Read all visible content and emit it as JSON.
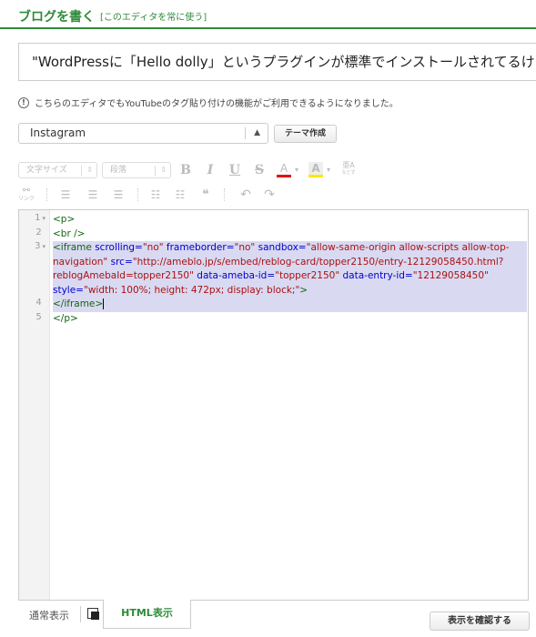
{
  "header": {
    "title": "ブログを書く",
    "link": "[このエディタを常に使う]"
  },
  "post": {
    "title_value": "\"WordPressに「Hello dolly」というプラグインが標準でインストールされてるけ\""
  },
  "notice": {
    "icon": "!",
    "text": "こちらのエディタでもYouTubeのタグ貼り付けの機能がご利用できるようになりました。"
  },
  "theme": {
    "selected": "Instagram",
    "create_button": "テーマ作成"
  },
  "toolbar": {
    "font_size": "文字サイズ",
    "paragraph": "段落",
    "bold": "B",
    "italic": "I",
    "underline": "U",
    "strike": "S",
    "font_color": "A",
    "bg_color": "A",
    "ruby_top": "亜A",
    "ruby_bottom": "などず",
    "link_top": "⚯",
    "link_label": "リンク",
    "quote": "❝",
    "undo": "↶",
    "redo": "↷"
  },
  "editor": {
    "line_numbers": [
      "1",
      "2",
      "3",
      "",
      "",
      "",
      "4",
      "5"
    ],
    "lines": [
      {
        "segments": [
          {
            "cls": "tag",
            "text": "<p>"
          }
        ]
      },
      {
        "segments": [
          {
            "cls": "plain",
            "text": "  "
          },
          {
            "cls": "tag",
            "text": "<br />"
          }
        ]
      },
      {
        "hl": true,
        "segments": [
          {
            "cls": "plain",
            "text": "  "
          },
          {
            "cls": "tag",
            "text": "<iframe "
          },
          {
            "cls": "attr",
            "text": "scrolling="
          },
          {
            "cls": "str",
            "text": "\"no\" "
          },
          {
            "cls": "attr",
            "text": "frameborder="
          },
          {
            "cls": "str",
            "text": "\"no\" "
          },
          {
            "cls": "attr",
            "text": "sandbox="
          },
          {
            "cls": "str",
            "text": "\"allow-same-origin allow-scripts allow-top-"
          }
        ]
      },
      {
        "hl": true,
        "segments": [
          {
            "cls": "str",
            "text": "navigation\" "
          },
          {
            "cls": "attr",
            "text": "src="
          },
          {
            "cls": "str",
            "text": "\"http://ameblo.jp/s/embed/reblog-card/topper2150/entry-12129058450.html?"
          }
        ]
      },
      {
        "hl": true,
        "segments": [
          {
            "cls": "str",
            "text": "reblogAmebaId=topper2150\" "
          },
          {
            "cls": "attr",
            "text": "data-ameba-id="
          },
          {
            "cls": "str",
            "text": "\"topper2150\" "
          },
          {
            "cls": "attr",
            "text": "data-entry-id="
          },
          {
            "cls": "str",
            "text": "\"12129058450\""
          }
        ]
      },
      {
        "hl": true,
        "segments": [
          {
            "cls": "attr",
            "text": "style="
          },
          {
            "cls": "str",
            "text": "\"width: 100%; height: 472px; display: block;\""
          },
          {
            "cls": "tag",
            "text": ">"
          }
        ]
      },
      {
        "hl": true,
        "cursor": true,
        "segments": [
          {
            "cls": "plain",
            "text": "  "
          },
          {
            "cls": "tag",
            "text": "</iframe>"
          }
        ]
      },
      {
        "segments": [
          {
            "cls": "tag",
            "text": "</p>"
          }
        ]
      }
    ]
  },
  "tabs": {
    "normal": "通常表示",
    "html": "HTML表示"
  },
  "confirm_button": "表示を確認する",
  "colors": {
    "brand_green": "#2e8b3a",
    "highlight": "#d9d9f2",
    "font_color_underline": "#e60012",
    "bg_color_fill": "#ffe600"
  }
}
